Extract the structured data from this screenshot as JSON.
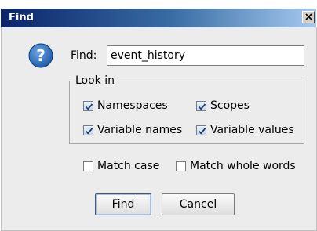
{
  "dialog": {
    "title": "Find",
    "close_glyph": "✕"
  },
  "icon": {
    "name": "question-icon",
    "glyph": "?",
    "color": "#1f5fa8"
  },
  "find": {
    "label": "Find:",
    "value": "event_history"
  },
  "look_in": {
    "legend": "Look in",
    "options": [
      {
        "label": "Namespaces",
        "checked": true
      },
      {
        "label": "Scopes",
        "checked": true
      },
      {
        "label": "Variable names",
        "checked": true
      },
      {
        "label": "Variable values",
        "checked": true
      }
    ]
  },
  "match": {
    "case_label": "Match case",
    "case_checked": false,
    "whole_words_label": "Match whole words",
    "whole_words_checked": false
  },
  "buttons": {
    "find_label": "Find",
    "cancel_label": "Cancel"
  }
}
